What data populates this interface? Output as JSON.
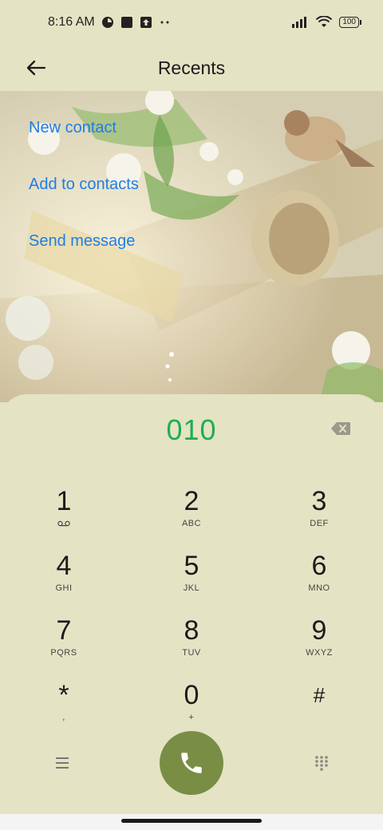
{
  "status_bar": {
    "time": "8:16 AM",
    "battery": "100",
    "icons": [
      "notification-app-icon",
      "square-notification-icon",
      "upload-notification-icon",
      "more-dots-icon",
      "signal-icon",
      "wifi-icon",
      "battery-icon"
    ]
  },
  "header": {
    "title": "Recents",
    "back_icon": "arrow-left-icon"
  },
  "actions": [
    {
      "label": "New contact"
    },
    {
      "label": "Add to contacts"
    },
    {
      "label": "Send message"
    }
  ],
  "dialer": {
    "number": "010",
    "backspace_icon": "backspace-icon",
    "keys": [
      {
        "digit": "1",
        "letters": ""
      },
      {
        "digit": "2",
        "letters": "ABC"
      },
      {
        "digit": "3",
        "letters": "DEF"
      },
      {
        "digit": "4",
        "letters": "GHI"
      },
      {
        "digit": "5",
        "letters": "JKL"
      },
      {
        "digit": "6",
        "letters": "MNO"
      },
      {
        "digit": "7",
        "letters": "PQRS"
      },
      {
        "digit": "8",
        "letters": "TUV"
      },
      {
        "digit": "9",
        "letters": "WXYZ"
      },
      {
        "digit": "*",
        "letters": ","
      },
      {
        "digit": "0",
        "letters": "+"
      },
      {
        "digit": "#",
        "letters": ""
      }
    ],
    "bottom": {
      "menu_icon": "menu-icon",
      "call_icon": "phone-icon",
      "dialpad_icon": "dialpad-icon"
    }
  },
  "colors": {
    "background": "#e4e3c4",
    "link": "#1e7ee6",
    "number": "#1fae4f",
    "call_button": "#7a8d45"
  }
}
